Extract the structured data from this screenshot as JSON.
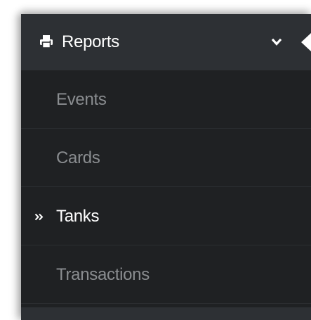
{
  "menu": {
    "header": {
      "label": "Reports",
      "icon": "printer-icon",
      "expand_icon": "chevron-down-icon",
      "collapse_icon": "caret-left-icon"
    },
    "items": [
      {
        "label": "Events",
        "active": false
      },
      {
        "label": "Cards",
        "active": false
      },
      {
        "label": "Tanks",
        "active": true
      },
      {
        "label": "Transactions",
        "active": false
      }
    ],
    "active_marker_icon": "double-chevron-right-icon"
  },
  "colors": {
    "header_bg": "#2d3034",
    "submenu_bg": "#1f2123",
    "inactive_text": "#8a8d90",
    "active_text": "#ffffff"
  }
}
